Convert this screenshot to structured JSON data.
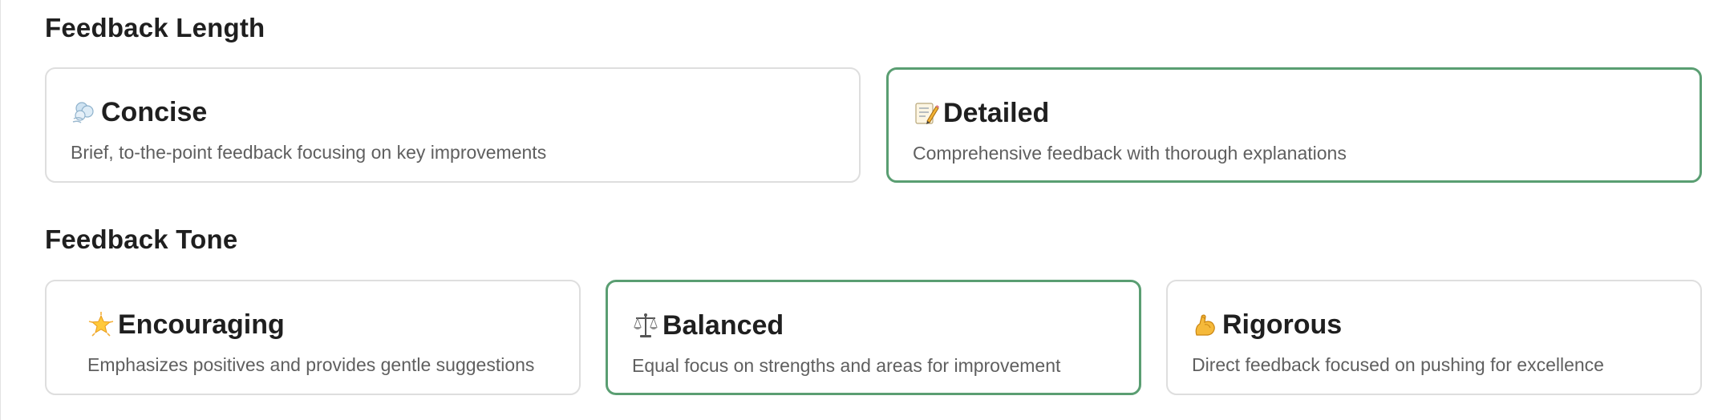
{
  "feedback_length": {
    "heading": "Feedback Length",
    "options": [
      {
        "icon": "wind-puff-icon",
        "title": "Concise",
        "description": "Brief, to-the-point feedback focusing on key improvements",
        "selected": false
      },
      {
        "icon": "memo-pencil-icon",
        "title": "Detailed",
        "description": "Comprehensive feedback with thorough explanations",
        "selected": true
      }
    ]
  },
  "feedback_tone": {
    "heading": "Feedback Tone",
    "options": [
      {
        "icon": "glowing-star-icon",
        "title": "Encouraging",
        "description": "Emphasizes positives and provides gentle suggestions",
        "selected": false
      },
      {
        "icon": "balance-scale-icon",
        "title": "Balanced",
        "description": "Equal focus on strengths and areas for improvement",
        "selected": true
      },
      {
        "icon": "flexed-biceps-icon",
        "title": "Rigorous",
        "description": "Direct feedback focused on pushing for excellence",
        "selected": false
      }
    ]
  },
  "colors": {
    "selected_border": "#5a9e72",
    "default_border": "#dedede",
    "title_text": "#1f1f1f",
    "description_text": "#5f5f5f"
  }
}
